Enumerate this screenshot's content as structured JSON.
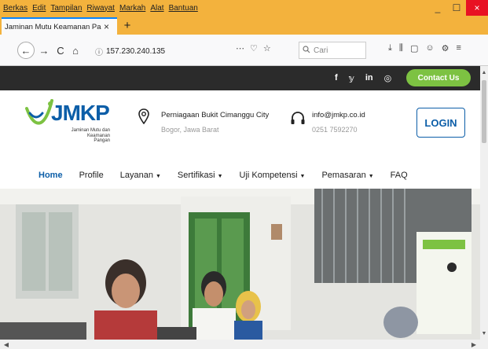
{
  "browser": {
    "menu": [
      "Berkas",
      "Edit",
      "Tampilan",
      "Riwayat",
      "Markah",
      "Alat",
      "Bantuan"
    ],
    "window_controls": {
      "minimize": "_",
      "maximize": "☐",
      "close": "×"
    },
    "tab": {
      "title": "Jaminan Mutu Keamanan Pangan (",
      "close": "×"
    },
    "new_tab": "+",
    "url": "157.230.240.135",
    "url_info_icon": "ⓘ",
    "url_actions": [
      "⋯",
      "♡",
      "☆"
    ],
    "search_placeholder": "Cari",
    "tools": [
      "⤓",
      "⫼",
      "▢",
      "☺",
      "⚙",
      "≡"
    ],
    "nav": {
      "back": "←",
      "forward": "→",
      "reload": "C",
      "home": "⌂"
    }
  },
  "site": {
    "social": [
      "f",
      "𝕪",
      "in",
      "◎"
    ],
    "contact_button": "Contact Us",
    "logo": {
      "name": "JMKP",
      "tagline_1": "Jaminan Mutu dan",
      "tagline_2": "Keamanan Pangan"
    },
    "address": {
      "line1": "Perniagaan Bukit Cimanggu City",
      "line2": "Bogor, Jawa Barat"
    },
    "contact": {
      "email": "info@jmkp.co.id",
      "phone": "0251 7592270"
    },
    "login_button": "LOGIN",
    "nav": [
      {
        "label": "Home",
        "dropdown": false,
        "active": true
      },
      {
        "label": "Profile",
        "dropdown": false,
        "active": false
      },
      {
        "label": "Layanan",
        "dropdown": true,
        "active": false
      },
      {
        "label": "Sertifikasi",
        "dropdown": true,
        "active": false
      },
      {
        "label": "Uji Kompetensi",
        "dropdown": true,
        "active": false
      },
      {
        "label": "Pemasaran",
        "dropdown": true,
        "active": false
      },
      {
        "label": "FAQ",
        "dropdown": false,
        "active": false
      }
    ],
    "caret": "▼"
  },
  "colors": {
    "titlebar": "#f3b23d",
    "brand_blue": "#0c5ea8",
    "brand_green": "#7dc242",
    "topstrip": "#2b2b2b"
  }
}
